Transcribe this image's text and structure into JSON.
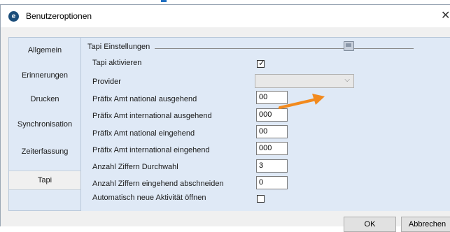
{
  "window": {
    "title": "Benutzeroptionen",
    "app_icon_letter": "e",
    "close_glyph": "✕"
  },
  "sidebar": {
    "items": [
      {
        "label": "Allgemein",
        "active": false
      },
      {
        "label": "Erinnerungen",
        "active": false
      },
      {
        "label": "Drucken",
        "active": false
      },
      {
        "label": "Synchronisation",
        "active": false
      },
      {
        "label": "Zeiterfassung",
        "active": false
      },
      {
        "label": "Tapi",
        "active": true
      }
    ]
  },
  "tapi": {
    "group_title": "Tapi Einstellungen",
    "activate": {
      "label": "Tapi aktivieren",
      "checked": true
    },
    "provider": {
      "label": "Provider",
      "value": "",
      "enabled": false
    },
    "fields": [
      {
        "label": "Präfix Amt national ausgehend",
        "value": "00"
      },
      {
        "label": "Präfix Amt international ausgehend",
        "value": "000"
      },
      {
        "label": "Präfix Amt national eingehend",
        "value": "00"
      },
      {
        "label": "Präfix Amt international eingehend",
        "value": "000"
      },
      {
        "label": "Anzahl Ziffern Durchwahl",
        "value": "3"
      },
      {
        "label": "Anzahl Ziffern eingehend abschneiden",
        "value": "0"
      }
    ],
    "auto_open": {
      "label": "Automatisch neue Aktivität öffnen",
      "checked": false
    }
  },
  "footer": {
    "ok_label": "OK",
    "cancel_label": "Abbrechen"
  },
  "colors": {
    "annotation_arrow": "#f28a1e",
    "sidebar_bg": "#dfe9f6",
    "window_bg": "#f0f0f0"
  }
}
